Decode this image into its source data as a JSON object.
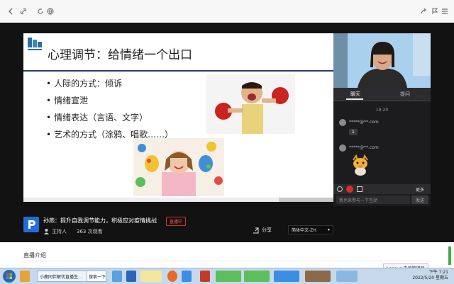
{
  "browser": {
    "icons": [
      "back-icon",
      "refresh-icon",
      "home-icon",
      "globe-icon",
      "share-icon",
      "flag-icon",
      "menu-icon"
    ]
  },
  "slide": {
    "title": "心理调节：给情绪一个出口",
    "bullets": [
      "人际的方式：倾诉",
      "情绪宣泄",
      "情绪表达（言语、文字）",
      "艺术的方式（涂鸦、唱歌……）"
    ]
  },
  "chat": {
    "tabs": [
      "聊天",
      "提问"
    ],
    "time": "19:20",
    "messages": [
      {
        "name": "*****@**.com",
        "content": "1"
      },
      {
        "name": "*****@**.com",
        "content": "sticker"
      }
    ],
    "more_label": "更多",
    "input_placeholder": "我也来参与一下互动",
    "send_label": "发送"
  },
  "stream": {
    "title": "孙燕：提升自我调节能力，积极应对疫情挑战",
    "live_badge": "直播中",
    "host_label": "主持人",
    "views": "363 次观看",
    "share_label": "分享",
    "language": "简体中文-ZH"
  },
  "page": {
    "section_title": "直播介绍"
  },
  "taskbar": {
    "items": [
      "小鹿同伴解忧直播生…",
      "搜索一下"
    ],
    "notification": "Lenovo 电源管理器",
    "time": "下午 7:21",
    "date": "2022/5/20 星期五"
  },
  "colors": {
    "player_bg": "#121212",
    "accent_red": "#d93025",
    "slide_rule": "#2a3b6a",
    "taskbar": "#c7d8ea"
  }
}
